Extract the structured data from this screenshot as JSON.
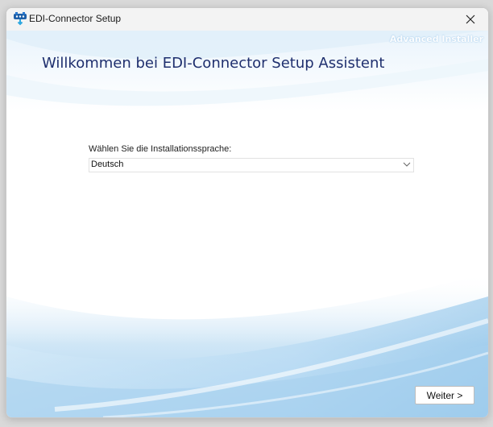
{
  "window": {
    "title": "EDI-Connector Setup",
    "icons": {
      "app": "installer-app-icon",
      "close": "close-icon"
    }
  },
  "branding": {
    "text": "Advanced Installer"
  },
  "main": {
    "heading": "Willkommen bei EDI-Connector Setup Assistent",
    "language_label": "Wählen Sie die Installationssprache:",
    "language_selected": "Deutsch",
    "dropdown_icon": "chevron-down-icon"
  },
  "footer": {
    "next_label": "Weiter >"
  },
  "colors": {
    "heading": "#1f2f6e",
    "wave_light": "#e6f2fb",
    "wave_mid": "#b9daf2",
    "wave_dark": "#6fb0e0",
    "titlebar": "#f3f3f3"
  }
}
